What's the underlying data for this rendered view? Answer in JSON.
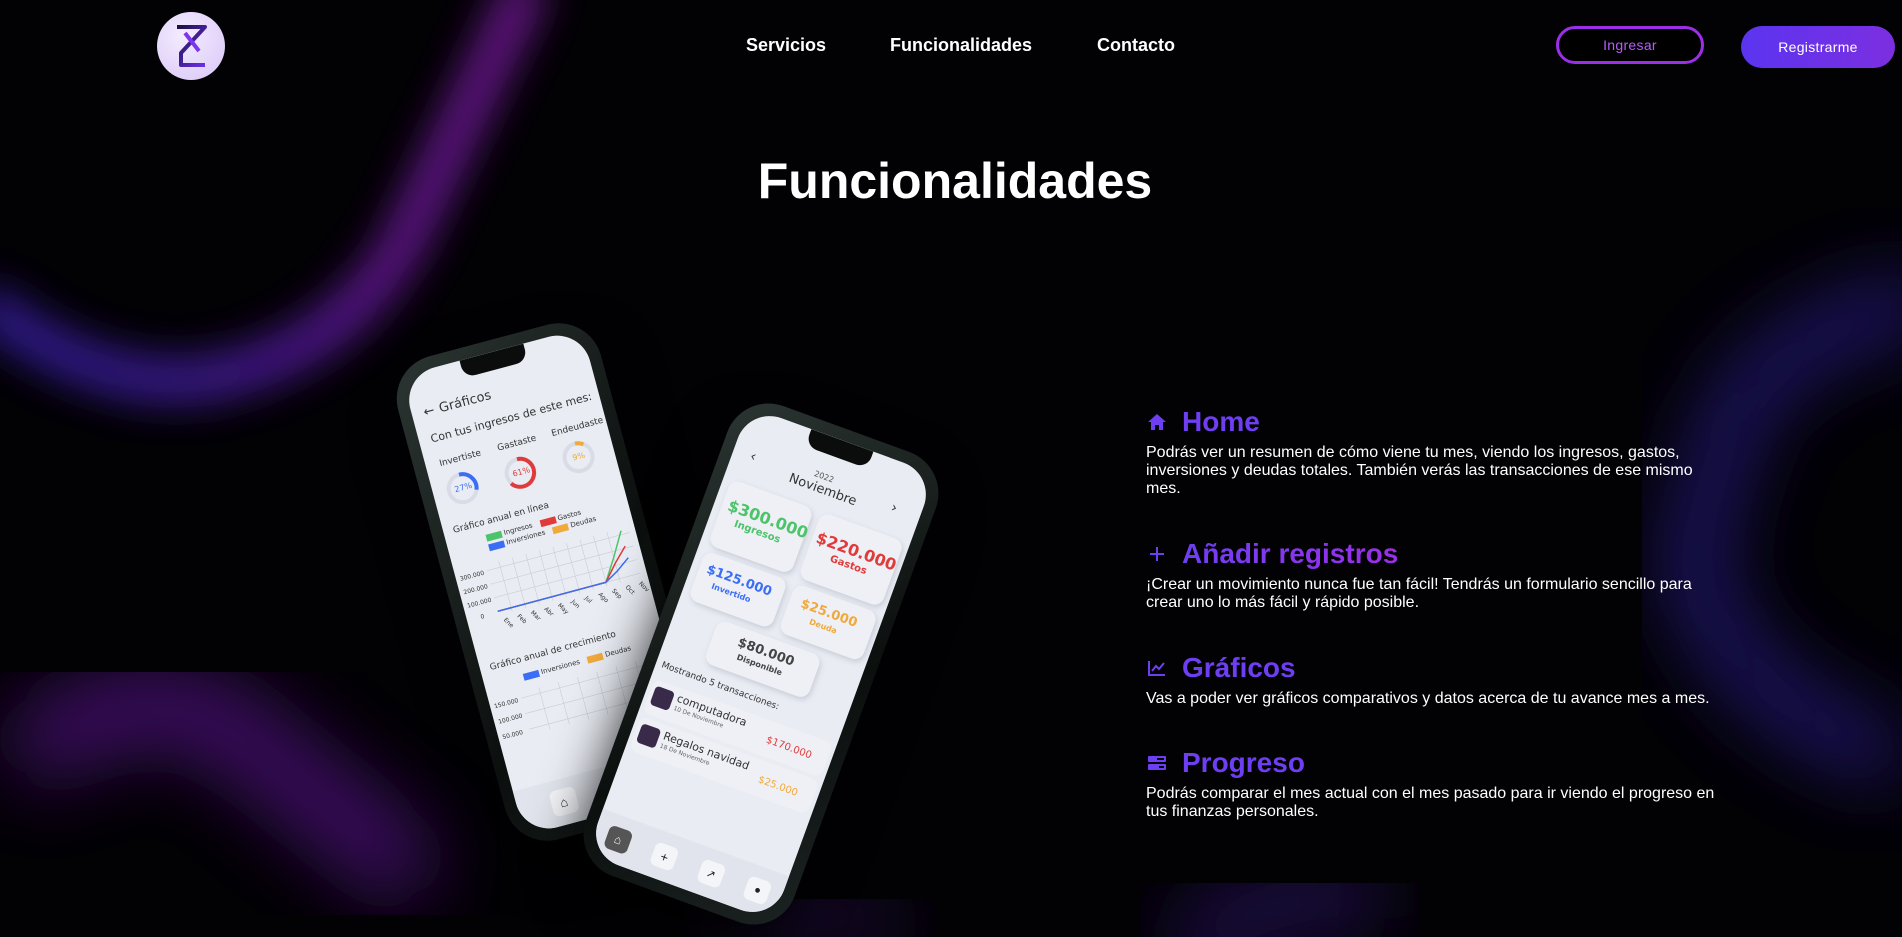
{
  "nav": {
    "links": [
      "Servicios",
      "Funcionalidades",
      "Contacto"
    ],
    "login_label": "Ingresar",
    "register_label": "Registrarme"
  },
  "section": {
    "title": "Funcionalidades"
  },
  "phone_left": {
    "back_label": "Gráficos",
    "subtitle": "Con tus ingresos de este mes:",
    "stats": [
      {
        "label": "Invertiste",
        "value": "27%",
        "color": "#3b6ef5"
      },
      {
        "label": "Gastaste",
        "value": "61%",
        "color": "#e03b3b"
      },
      {
        "label": "Endeudaste",
        "value": "9%",
        "color": "#f0a93b"
      }
    ],
    "line_chart_title": "Gráfico anual en línea",
    "legend": [
      "Ingresos",
      "Gastos",
      "Inversiones",
      "Deudas"
    ],
    "y_ticks": [
      "300.000",
      "200.000",
      "100.000",
      "0"
    ],
    "months": [
      "Ene",
      "Feb",
      "Mar",
      "Abr",
      "May",
      "Jun",
      "Jul",
      "Ago",
      "Sep",
      "Oct",
      "Nov"
    ],
    "growth_title": "Gráfico anual de crecimiento",
    "growth_legend": [
      "Inversiones",
      "Deudas"
    ],
    "growth_ticks": [
      "150.000",
      "100.000",
      "50.000"
    ]
  },
  "phone_right": {
    "year": "2022",
    "month": "Noviembre",
    "cards": [
      {
        "amount": "$300.000",
        "label": "Ingresos",
        "color": "#4cc46a"
      },
      {
        "amount": "$220.000",
        "label": "Gastos",
        "color": "#e03b3b"
      },
      {
        "amount": "$125.000",
        "label": "Invertido",
        "color": "#3b6ef5"
      },
      {
        "amount": "$25.000",
        "label": "Deuda",
        "color": "#f0a93b"
      }
    ],
    "available": {
      "amount": "$80.000",
      "label": "Disponible"
    },
    "tx_header": "Mostrando 5 transacciones:",
    "transactions": [
      {
        "name": "computadora",
        "date": "10 De Noviembre",
        "amount": "$170.000",
        "color": "#e03b3b"
      },
      {
        "name": "Regalos navidad",
        "date": "18 De Noviembre",
        "amount": "$25.000",
        "color": "#f0a93b"
      }
    ]
  },
  "features": [
    {
      "icon": "home-icon",
      "title": "Home",
      "desc": "Podrás ver un resumen de cómo viene tu mes, viendo los ingresos, gastos, inversiones y deudas totales. También verás las transacciones de ese mismo mes."
    },
    {
      "icon": "plus-icon",
      "title": "Añadir registros",
      "desc": "¡Crear un movimiento nunca fue tan fácil! Tendrás un formulario sencillo para crear uno lo más fácil y rápido posible."
    },
    {
      "icon": "chart-line-icon",
      "title": "Gráficos",
      "desc": "Vas a poder ver gráficos comparativos y datos acerca de tu avance mes a mes."
    },
    {
      "icon": "progress-icon",
      "title": "Progreso",
      "desc": "Podrás comparar el mes actual con el mes pasado para ir viendo el progreso en tus finanzas personales."
    }
  ],
  "colors": {
    "accent": "#6e3ff2",
    "neon_purple": "#8a1fc9",
    "neon_blue": "#4a2fd6"
  }
}
